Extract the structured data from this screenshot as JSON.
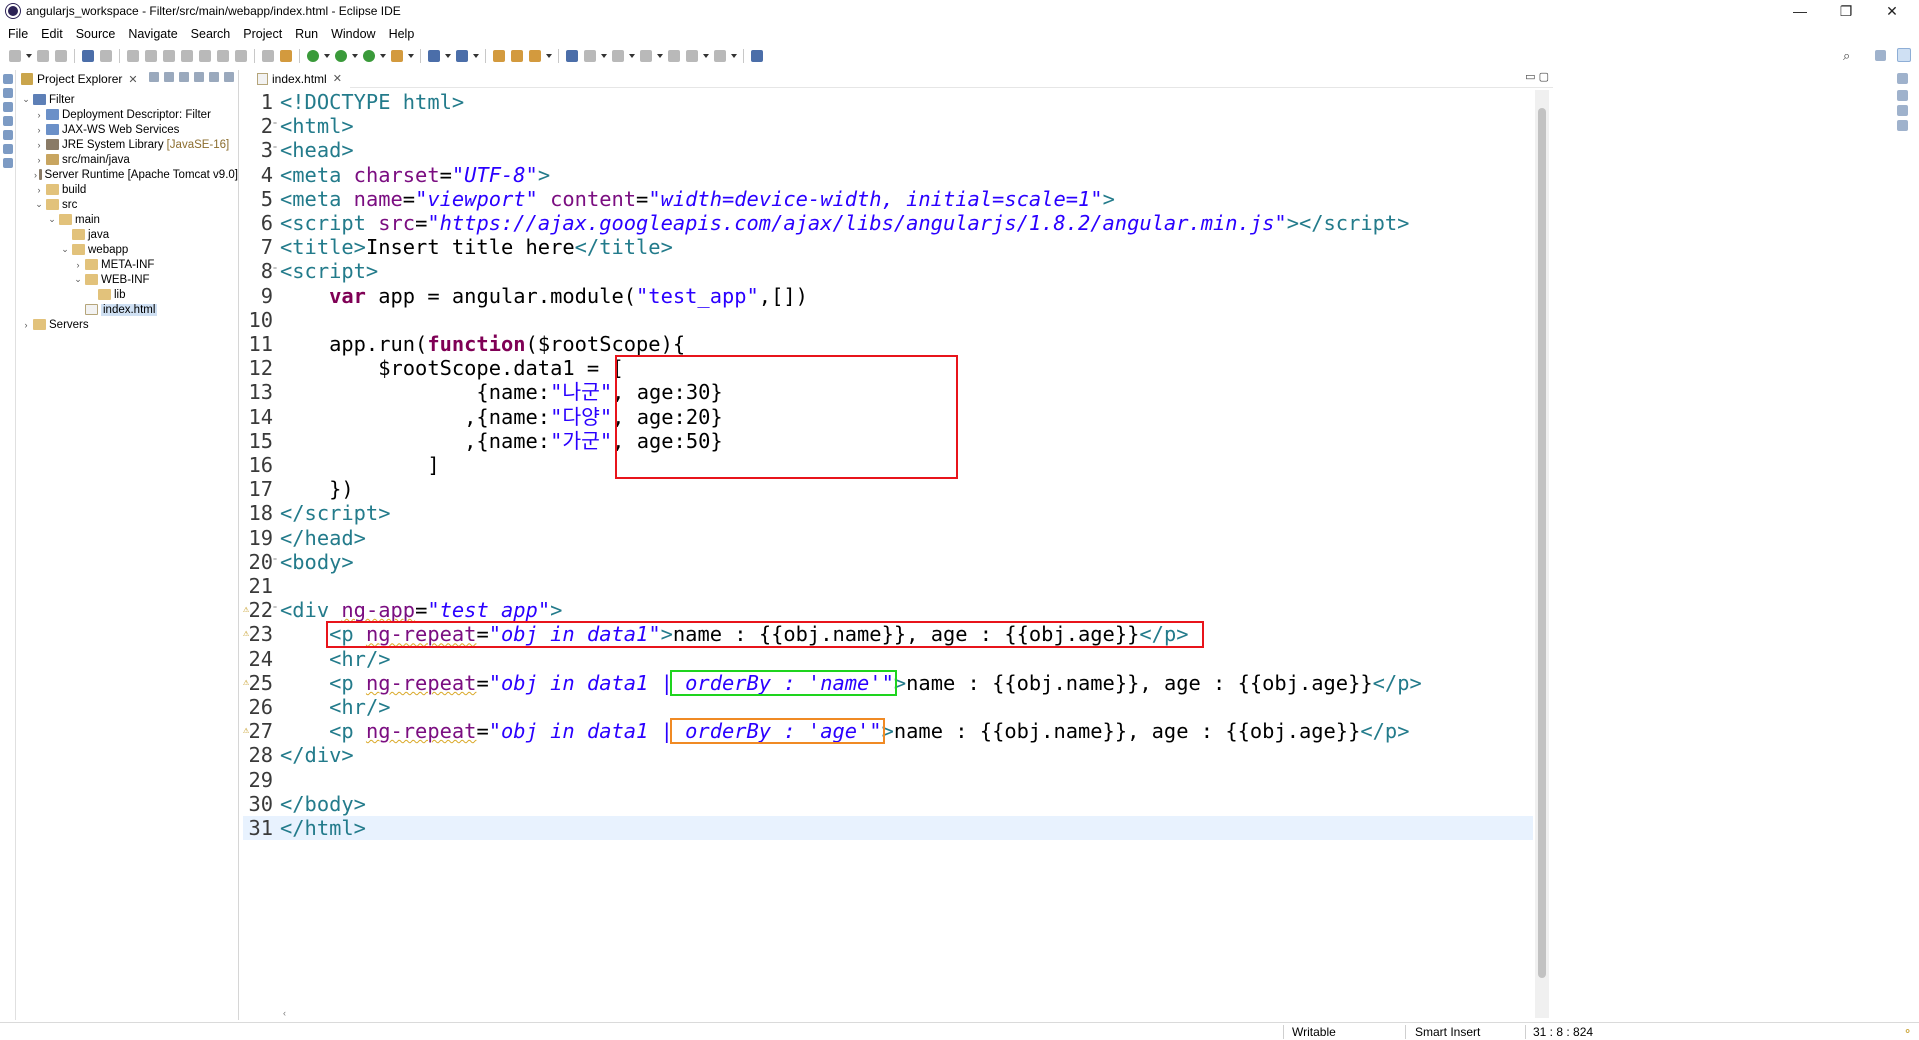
{
  "window": {
    "title": "angularjs_workspace - Filter/src/main/webapp/index.html - Eclipse IDE",
    "controls": {
      "minimize": "—",
      "restore": "❐",
      "close": "✕"
    }
  },
  "menubar": [
    "File",
    "Edit",
    "Source",
    "Navigate",
    "Search",
    "Project",
    "Run",
    "Window",
    "Help"
  ],
  "explorer": {
    "tab_label": "Project Explorer",
    "tree": [
      {
        "label": "Filter",
        "qualifier": "",
        "depth": 0,
        "expanded": true,
        "icon": "project-icon"
      },
      {
        "label": "Deployment Descriptor: Filter",
        "qualifier": "",
        "depth": 1,
        "expanded": false,
        "icon": "descriptor-icon"
      },
      {
        "label": "JAX-WS Web Services",
        "qualifier": "",
        "depth": 1,
        "expanded": false,
        "icon": "webservice-icon"
      },
      {
        "label": "JRE System Library",
        "qualifier": "[JavaSE-16]",
        "depth": 1,
        "expanded": false,
        "icon": "library-icon"
      },
      {
        "label": "src/main/java",
        "qualifier": "",
        "depth": 1,
        "expanded": false,
        "icon": "source-folder-icon"
      },
      {
        "label": "Server Runtime [Apache Tomcat v9.0]",
        "qualifier": "",
        "depth": 1,
        "expanded": false,
        "icon": "library-icon"
      },
      {
        "label": "build",
        "qualifier": "",
        "depth": 1,
        "expanded": false,
        "icon": "folder-icon"
      },
      {
        "label": "src",
        "qualifier": "",
        "depth": 1,
        "expanded": true,
        "icon": "folder-icon"
      },
      {
        "label": "main",
        "qualifier": "",
        "depth": 2,
        "expanded": true,
        "icon": "folder-icon"
      },
      {
        "label": "java",
        "qualifier": "",
        "depth": 3,
        "leaf": true,
        "icon": "folder-icon"
      },
      {
        "label": "webapp",
        "qualifier": "",
        "depth": 3,
        "expanded": true,
        "icon": "folder-icon"
      },
      {
        "label": "META-INF",
        "qualifier": "",
        "depth": 4,
        "expanded": false,
        "icon": "folder-icon"
      },
      {
        "label": "WEB-INF",
        "qualifier": "",
        "depth": 4,
        "expanded": true,
        "icon": "folder-icon"
      },
      {
        "label": "lib",
        "qualifier": "",
        "depth": 5,
        "leaf": true,
        "icon": "folder-icon"
      },
      {
        "label": "index.html",
        "qualifier": "",
        "depth": 4,
        "leaf": true,
        "selected": true,
        "icon": "html-file-icon"
      },
      {
        "label": "Servers",
        "qualifier": "",
        "depth": 0,
        "expanded": false,
        "icon": "servers-folder-icon"
      }
    ]
  },
  "editor": {
    "tab_label": "index.html",
    "lines": [
      {
        "n": "1",
        "fold": "",
        "warn": false,
        "html": "<span class=\"tag\">&lt;!DOCTYPE html&gt;</span>"
      },
      {
        "n": "2",
        "fold": "⊖",
        "warn": false,
        "html": "<span class=\"tag\">&lt;html&gt;</span>"
      },
      {
        "n": "3",
        "fold": "⊖",
        "warn": false,
        "html": "<span class=\"tag\">&lt;head&gt;</span>"
      },
      {
        "n": "4",
        "fold": "",
        "warn": false,
        "html": "<span class=\"tag\">&lt;meta</span> <span class=\"attr\">charset</span>=<span class=\"str\">\"UTF-8\"</span><span class=\"tag\">&gt;</span>"
      },
      {
        "n": "5",
        "fold": "",
        "warn": false,
        "html": "<span class=\"tag\">&lt;meta</span> <span class=\"attr\">name</span>=<span class=\"str\">\"viewport\"</span> <span class=\"attr\">content</span>=<span class=\"str\">\"width=device-width, initial=scale=1\"</span><span class=\"tag\">&gt;</span>"
      },
      {
        "n": "6",
        "fold": "",
        "warn": false,
        "html": "<span class=\"tag\">&lt;script</span> <span class=\"attr\">src</span>=<span class=\"str\">\"https://ajax.googleapis.com/ajax/libs/angularjs/1.8.2/angular.min.js\"</span><span class=\"tag\">&gt;&lt;/script&gt;</span>"
      },
      {
        "n": "7",
        "fold": "",
        "warn": false,
        "html": "<span class=\"tag\">&lt;title&gt;</span>Insert title here<span class=\"tag\">&lt;/title&gt;</span>"
      },
      {
        "n": "8",
        "fold": "⊖",
        "warn": false,
        "html": "<span class=\"tag\">&lt;script&gt;</span>"
      },
      {
        "n": "9",
        "fold": "",
        "warn": false,
        "html": "    <span class=\"kw\">var</span> app = angular.module(<span class=\"plain-str\">\"test_app\"</span>,[])"
      },
      {
        "n": "10",
        "fold": "",
        "warn": false,
        "html": ""
      },
      {
        "n": "11",
        "fold": "",
        "warn": false,
        "html": "    app.run(<span class=\"kw\">function</span>($rootScope){"
      },
      {
        "n": "12",
        "fold": "",
        "warn": false,
        "html": "        $rootScope.data1 = ["
      },
      {
        "n": "13",
        "fold": "",
        "warn": false,
        "html": "                {name:<span class=\"plain-str\">\"나군\"</span>, age:30}"
      },
      {
        "n": "14",
        "fold": "",
        "warn": false,
        "html": "               ,{name:<span class=\"plain-str\">\"다양\"</span>, age:20}"
      },
      {
        "n": "15",
        "fold": "",
        "warn": false,
        "html": "               ,{name:<span class=\"plain-str\">\"가군\"</span>, age:50}"
      },
      {
        "n": "16",
        "fold": "",
        "warn": false,
        "html": "            ]"
      },
      {
        "n": "17",
        "fold": "",
        "warn": false,
        "html": "    })"
      },
      {
        "n": "18",
        "fold": "",
        "warn": false,
        "html": "<span class=\"tag\">&lt;/script&gt;</span>"
      },
      {
        "n": "19",
        "fold": "",
        "warn": false,
        "html": "<span class=\"tag\">&lt;/head&gt;</span>"
      },
      {
        "n": "20",
        "fold": "⊖",
        "warn": false,
        "html": "<span class=\"tag\">&lt;body&gt;</span>"
      },
      {
        "n": "21",
        "fold": "",
        "warn": false,
        "html": ""
      },
      {
        "n": "22",
        "fold": "⊖",
        "warn": true,
        "html": "<span class=\"tag\">&lt;div</span> <span class=\"attr squiggle\">ng-app</span>=<span class=\"str\">\"test_app\"</span><span class=\"tag\">&gt;</span>"
      },
      {
        "n": "23",
        "fold": "",
        "warn": true,
        "html": "    <span class=\"tag\">&lt;p</span> <span class=\"attr squiggle\">ng-repeat</span>=<span class=\"str\">\"obj in data1\"</span><span class=\"tag\">&gt;</span>name : {{obj.name}}, age : {{obj.age}}<span class=\"tag\">&lt;/p&gt;</span>"
      },
      {
        "n": "24",
        "fold": "",
        "warn": false,
        "html": "    <span class=\"tag\">&lt;hr/&gt;</span>"
      },
      {
        "n": "25",
        "fold": "",
        "warn": true,
        "html": "    <span class=\"tag\">&lt;p</span> <span class=\"attr squiggle\">ng-repeat</span>=<span class=\"str\">\"obj in data1 | orderBy : 'name'\"</span><span class=\"tag\">&gt;</span>name : {{obj.name}}, age : {{obj.age}}<span class=\"tag\">&lt;/p&gt;</span>"
      },
      {
        "n": "26",
        "fold": "",
        "warn": false,
        "html": "    <span class=\"tag\">&lt;hr/&gt;</span>"
      },
      {
        "n": "27",
        "fold": "",
        "warn": true,
        "html": "    <span class=\"tag\">&lt;p</span> <span class=\"attr squiggle\">ng-repeat</span>=<span class=\"str\">\"obj in data1 | orderBy : 'age'\"</span><span class=\"tag\">&gt;</span>name : {{obj.name}}, age : {{obj.age}}<span class=\"tag\">&lt;/p&gt;</span>"
      },
      {
        "n": "28",
        "fold": "",
        "warn": false,
        "html": "<span class=\"tag\">&lt;/div&gt;</span>"
      },
      {
        "n": "29",
        "fold": "",
        "warn": false,
        "html": ""
      },
      {
        "n": "30",
        "fold": "",
        "warn": false,
        "html": "<span class=\"tag\">&lt;/body&gt;</span>"
      },
      {
        "n": "31",
        "fold": "",
        "warn": false,
        "current": true,
        "html": "<span class=\"tag\">&lt;/html&gt;</span>"
      }
    ],
    "annotations": [
      {
        "name": "array-highlight-box",
        "color": "#e8141b"
      },
      {
        "name": "repeat-plain-highlight-box",
        "color": "#e8141b"
      },
      {
        "name": "orderby-name-highlight-box",
        "color": "#1ed41e"
      },
      {
        "name": "orderby-age-highlight-box",
        "color": "#f08a24"
      }
    ]
  },
  "statusbar": {
    "mode": "Writable",
    "insert": "Smart Insert",
    "position": "31 : 8 : 824"
  }
}
